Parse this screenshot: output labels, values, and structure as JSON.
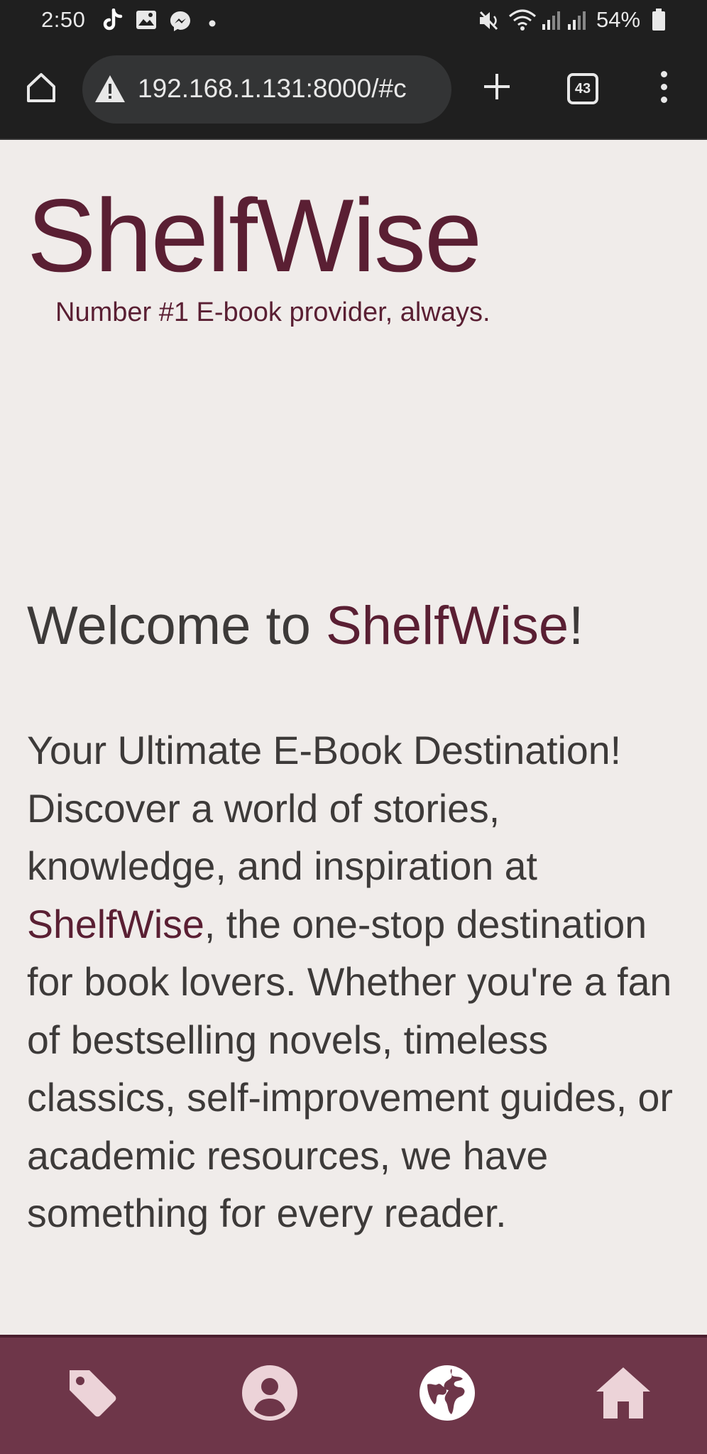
{
  "status_bar": {
    "time": "2:50",
    "battery": "54%",
    "icons": [
      "tiktok-icon",
      "gallery-icon",
      "messenger-icon",
      "dot-icon",
      "mute-icon",
      "wifi-icon",
      "signal-icon",
      "signal-icon",
      "battery-icon"
    ]
  },
  "browser": {
    "url": "192.168.1.131:8000/#c",
    "tab_count": "43",
    "icons": [
      "home-icon",
      "warning-icon",
      "plus-icon",
      "tabs-icon",
      "more-vert-icon"
    ]
  },
  "header": {
    "brand": "ShelfWise",
    "tagline": "Number #1 E-book provider, always."
  },
  "main": {
    "welcome_prefix": "Welcome to ",
    "welcome_brand": "ShelfWise",
    "welcome_suffix": "!",
    "intro_part1": "Your Ultimate E-Book Destination! Discover a world of stories, knowledge, and inspiration at ",
    "intro_brand": "ShelfWise",
    "intro_part2": ", the one-stop destination for book lovers. Whether you're a fan of bestselling novels, timeless classics, self-improvement guides, or academic resources, we have something for every reader."
  },
  "bottom_nav": {
    "items": [
      {
        "icon": "tag-icon"
      },
      {
        "icon": "user-icon"
      },
      {
        "icon": "globe-icon"
      },
      {
        "icon": "home-icon"
      }
    ]
  },
  "colors": {
    "brand": "#5a1f33",
    "nav_background": "#6e3649",
    "nav_icon": "#ecd3d8",
    "page_background": "#f0ecea",
    "text": "#3d3a39",
    "browser_chrome": "#1f1f1f"
  }
}
